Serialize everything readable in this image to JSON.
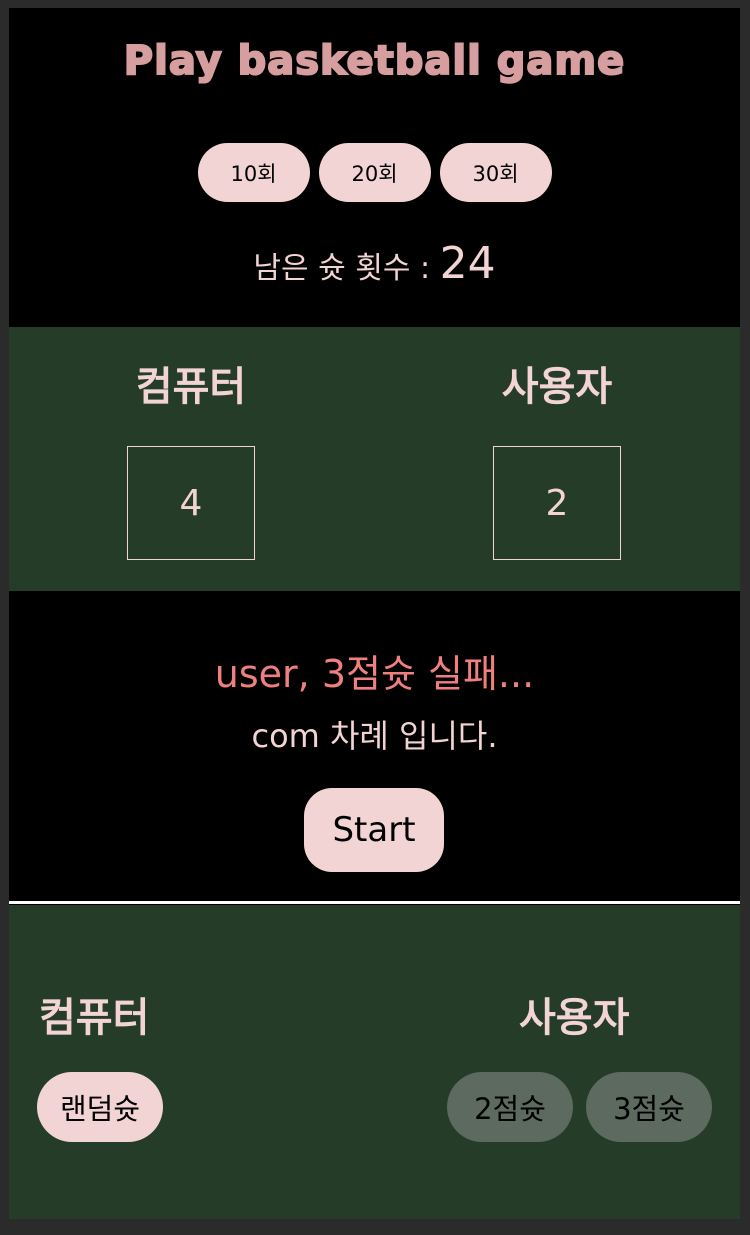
{
  "title": "Play basketball game",
  "rounds": [
    {
      "label": "10회"
    },
    {
      "label": "20회"
    },
    {
      "label": "30회"
    }
  ],
  "shots_left": {
    "label": "남은 슛 횟수 : ",
    "value": "24"
  },
  "scoreboard": {
    "computer": {
      "name": "컴퓨터",
      "score": "4"
    },
    "user": {
      "name": "사용자",
      "score": "2"
    }
  },
  "message": {
    "result": "user, 3점슛 실패...",
    "turn": "com 차례 입니다.",
    "start_label": "Start"
  },
  "controls": {
    "computer": {
      "name": "컴퓨터",
      "random_shot_label": "랜덤슛"
    },
    "user": {
      "name": "사용자",
      "two_point_label": "2점슛",
      "three_point_label": "3점슛"
    }
  },
  "colors": {
    "accent_pink": "#f2d4d4",
    "title_pink": "#d69e9f",
    "fail_red": "#f08080",
    "board_green": "#253c29",
    "disabled_green": "#5d6a5f"
  }
}
